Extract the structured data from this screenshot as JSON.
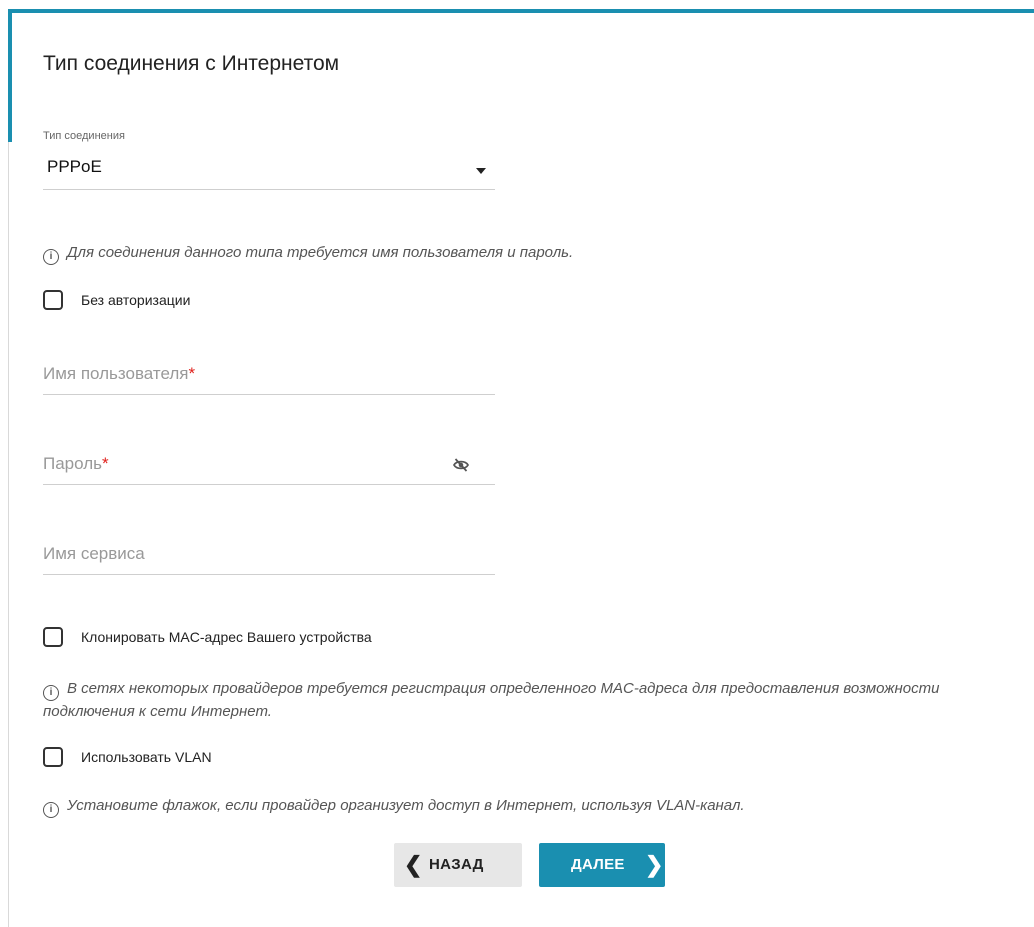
{
  "page": {
    "title": "Тип соединения с Интернетом"
  },
  "connection_type": {
    "label": "Тип соединения",
    "value": "PPPoE"
  },
  "info_auth": "Для соединения данного типа требуется имя пользователя и пароль.",
  "no_auth_checkbox": {
    "label": "Без авторизации",
    "checked": false
  },
  "username": {
    "placeholder": "Имя пользователя",
    "value": ""
  },
  "password": {
    "placeholder": "Пароль",
    "value": ""
  },
  "required_mark": "*",
  "service_name": {
    "placeholder": "Имя сервиса",
    "value": ""
  },
  "clone_mac_checkbox": {
    "label": "Клонировать MAC-адрес Вашего устройства",
    "checked": false
  },
  "info_mac": "В сетях некоторых провайдеров требуется регистрация определенного MAC-адреса для предоставления возможности подключения к сети Интернет.",
  "vlan_checkbox": {
    "label": "Использовать VLAN",
    "checked": false
  },
  "info_vlan": "Установите флажок, если провайдер организует доступ в Интернет, используя VLAN-канал.",
  "buttons": {
    "back": "НАЗАД",
    "next": "ДАЛЕЕ"
  },
  "icons": {
    "info": "info-circle-icon",
    "caret": "caret-down-icon",
    "password_toggle": "eye-off-icon",
    "back": "chevron-left-icon",
    "next": "chevron-right-icon"
  },
  "colors": {
    "accent": "#1a8fb0",
    "required": "#e0201b"
  }
}
